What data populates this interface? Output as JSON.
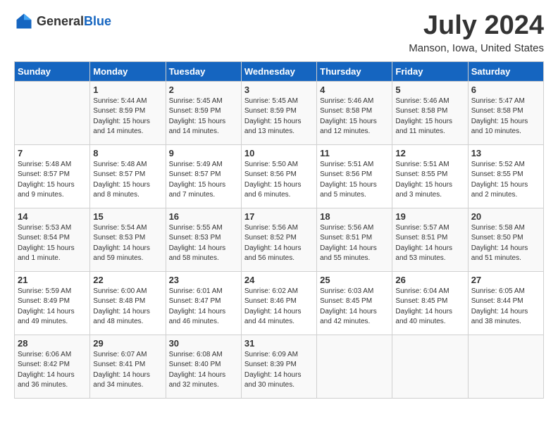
{
  "header": {
    "logo_general": "General",
    "logo_blue": "Blue",
    "month_year": "July 2024",
    "location": "Manson, Iowa, United States"
  },
  "weekdays": [
    "Sunday",
    "Monday",
    "Tuesday",
    "Wednesday",
    "Thursday",
    "Friday",
    "Saturday"
  ],
  "weeks": [
    [
      {
        "day": "",
        "content": ""
      },
      {
        "day": "1",
        "content": "Sunrise: 5:44 AM\nSunset: 8:59 PM\nDaylight: 15 hours\nand 14 minutes."
      },
      {
        "day": "2",
        "content": "Sunrise: 5:45 AM\nSunset: 8:59 PM\nDaylight: 15 hours\nand 14 minutes."
      },
      {
        "day": "3",
        "content": "Sunrise: 5:45 AM\nSunset: 8:59 PM\nDaylight: 15 hours\nand 13 minutes."
      },
      {
        "day": "4",
        "content": "Sunrise: 5:46 AM\nSunset: 8:58 PM\nDaylight: 15 hours\nand 12 minutes."
      },
      {
        "day": "5",
        "content": "Sunrise: 5:46 AM\nSunset: 8:58 PM\nDaylight: 15 hours\nand 11 minutes."
      },
      {
        "day": "6",
        "content": "Sunrise: 5:47 AM\nSunset: 8:58 PM\nDaylight: 15 hours\nand 10 minutes."
      }
    ],
    [
      {
        "day": "7",
        "content": "Sunrise: 5:48 AM\nSunset: 8:57 PM\nDaylight: 15 hours\nand 9 minutes."
      },
      {
        "day": "8",
        "content": "Sunrise: 5:48 AM\nSunset: 8:57 PM\nDaylight: 15 hours\nand 8 minutes."
      },
      {
        "day": "9",
        "content": "Sunrise: 5:49 AM\nSunset: 8:57 PM\nDaylight: 15 hours\nand 7 minutes."
      },
      {
        "day": "10",
        "content": "Sunrise: 5:50 AM\nSunset: 8:56 PM\nDaylight: 15 hours\nand 6 minutes."
      },
      {
        "day": "11",
        "content": "Sunrise: 5:51 AM\nSunset: 8:56 PM\nDaylight: 15 hours\nand 5 minutes."
      },
      {
        "day": "12",
        "content": "Sunrise: 5:51 AM\nSunset: 8:55 PM\nDaylight: 15 hours\nand 3 minutes."
      },
      {
        "day": "13",
        "content": "Sunrise: 5:52 AM\nSunset: 8:55 PM\nDaylight: 15 hours\nand 2 minutes."
      }
    ],
    [
      {
        "day": "14",
        "content": "Sunrise: 5:53 AM\nSunset: 8:54 PM\nDaylight: 15 hours\nand 1 minute."
      },
      {
        "day": "15",
        "content": "Sunrise: 5:54 AM\nSunset: 8:53 PM\nDaylight: 14 hours\nand 59 minutes."
      },
      {
        "day": "16",
        "content": "Sunrise: 5:55 AM\nSunset: 8:53 PM\nDaylight: 14 hours\nand 58 minutes."
      },
      {
        "day": "17",
        "content": "Sunrise: 5:56 AM\nSunset: 8:52 PM\nDaylight: 14 hours\nand 56 minutes."
      },
      {
        "day": "18",
        "content": "Sunrise: 5:56 AM\nSunset: 8:51 PM\nDaylight: 14 hours\nand 55 minutes."
      },
      {
        "day": "19",
        "content": "Sunrise: 5:57 AM\nSunset: 8:51 PM\nDaylight: 14 hours\nand 53 minutes."
      },
      {
        "day": "20",
        "content": "Sunrise: 5:58 AM\nSunset: 8:50 PM\nDaylight: 14 hours\nand 51 minutes."
      }
    ],
    [
      {
        "day": "21",
        "content": "Sunrise: 5:59 AM\nSunset: 8:49 PM\nDaylight: 14 hours\nand 49 minutes."
      },
      {
        "day": "22",
        "content": "Sunrise: 6:00 AM\nSunset: 8:48 PM\nDaylight: 14 hours\nand 48 minutes."
      },
      {
        "day": "23",
        "content": "Sunrise: 6:01 AM\nSunset: 8:47 PM\nDaylight: 14 hours\nand 46 minutes."
      },
      {
        "day": "24",
        "content": "Sunrise: 6:02 AM\nSunset: 8:46 PM\nDaylight: 14 hours\nand 44 minutes."
      },
      {
        "day": "25",
        "content": "Sunrise: 6:03 AM\nSunset: 8:45 PM\nDaylight: 14 hours\nand 42 minutes."
      },
      {
        "day": "26",
        "content": "Sunrise: 6:04 AM\nSunset: 8:45 PM\nDaylight: 14 hours\nand 40 minutes."
      },
      {
        "day": "27",
        "content": "Sunrise: 6:05 AM\nSunset: 8:44 PM\nDaylight: 14 hours\nand 38 minutes."
      }
    ],
    [
      {
        "day": "28",
        "content": "Sunrise: 6:06 AM\nSunset: 8:42 PM\nDaylight: 14 hours\nand 36 minutes."
      },
      {
        "day": "29",
        "content": "Sunrise: 6:07 AM\nSunset: 8:41 PM\nDaylight: 14 hours\nand 34 minutes."
      },
      {
        "day": "30",
        "content": "Sunrise: 6:08 AM\nSunset: 8:40 PM\nDaylight: 14 hours\nand 32 minutes."
      },
      {
        "day": "31",
        "content": "Sunrise: 6:09 AM\nSunset: 8:39 PM\nDaylight: 14 hours\nand 30 minutes."
      },
      {
        "day": "",
        "content": ""
      },
      {
        "day": "",
        "content": ""
      },
      {
        "day": "",
        "content": ""
      }
    ]
  ]
}
